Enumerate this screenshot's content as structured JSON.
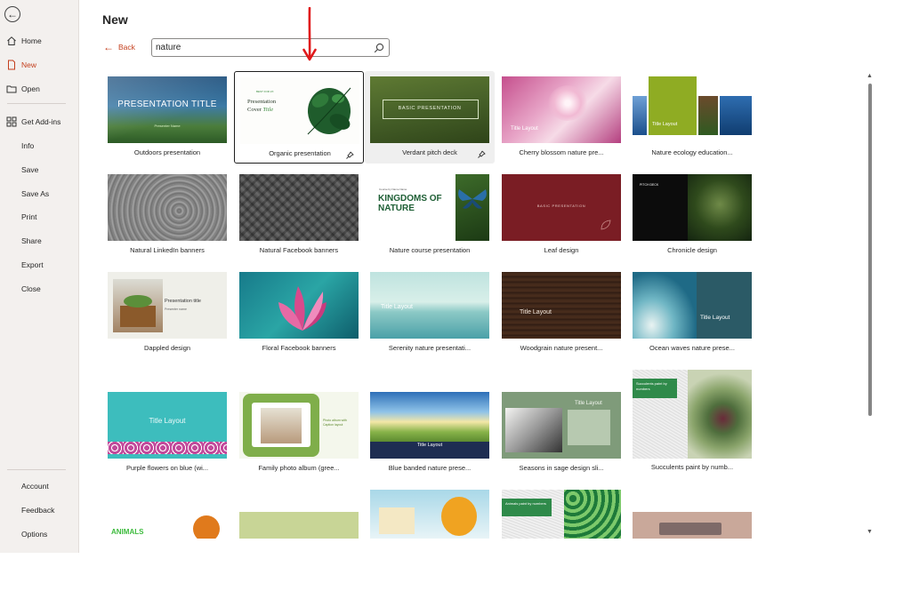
{
  "sidebar": {
    "items": [
      {
        "label": "Home"
      },
      {
        "label": "New"
      },
      {
        "label": "Open"
      },
      {
        "label": "Get Add-ins"
      },
      {
        "label": "Info"
      },
      {
        "label": "Save"
      },
      {
        "label": "Save As"
      },
      {
        "label": "Print"
      },
      {
        "label": "Share"
      },
      {
        "label": "Export"
      },
      {
        "label": "Close"
      }
    ],
    "bottom_items": [
      {
        "label": "Account"
      },
      {
        "label": "Feedback"
      },
      {
        "label": "Options"
      }
    ],
    "active": "New"
  },
  "header": {
    "title": "New",
    "back_label": "Back"
  },
  "search": {
    "value": "nature",
    "icon": "search-icon"
  },
  "colors": {
    "accent": "#c43e1c",
    "annotation_arrow": "#e0191b",
    "sidebar_bg": "#f3f0ee"
  },
  "templates": [
    {
      "name": "Outdoors presentation",
      "thumb": {
        "title": "PRESENTATION TITLE",
        "subtitle": "Presenter Name"
      }
    },
    {
      "name": "Organic presentation",
      "thumb": {
        "line1": "Presentation",
        "line2": "Cover",
        "line3": "Title",
        "tag": "BEST FOR 2X"
      },
      "selected": true
    },
    {
      "name": "Verdant pitch deck",
      "thumb": {
        "title": "BASIC PRESENTATION"
      },
      "hover": true
    },
    {
      "name": "Cherry blossom nature pre...",
      "thumb": {
        "title": "Title Layout"
      }
    },
    {
      "name": "Nature ecology education...",
      "thumb": {
        "title": "Title Layout"
      }
    },
    {
      "name": "Natural LinkedIn banners",
      "thumb": {}
    },
    {
      "name": "Natural Facebook banners",
      "thumb": {}
    },
    {
      "name": "Nature course presentation",
      "thumb": {
        "title": "KINGDOMS OF NATURE",
        "top": "Course by Name Name"
      }
    },
    {
      "name": "Leaf design",
      "thumb": {
        "title": "BASIC PRESENTATION"
      }
    },
    {
      "name": "Chronicle design",
      "thumb": {
        "title": "PITCH DECK"
      }
    },
    {
      "name": "Dappled design",
      "thumb": {
        "title": "Presentation title",
        "subtitle": "Presenter name"
      }
    },
    {
      "name": "Floral Facebook banners",
      "thumb": {}
    },
    {
      "name": "Serenity nature presentati...",
      "thumb": {
        "title": "Title Layout"
      }
    },
    {
      "name": "Woodgrain nature present...",
      "thumb": {
        "title": "Title Layout"
      }
    },
    {
      "name": "Ocean waves nature prese...",
      "thumb": {
        "title": "Title Layout"
      }
    },
    {
      "name": "Purple flowers on blue (wi...",
      "thumb": {
        "title": "Title Layout"
      }
    },
    {
      "name": "Family photo album (gree...",
      "thumb": {
        "title": "Photo album with Caption layout"
      }
    },
    {
      "name": "Blue banded nature prese...",
      "thumb": {
        "title": "Title Layout"
      }
    },
    {
      "name": "Seasons in sage design sli...",
      "thumb": {
        "title": "Title Layout"
      }
    },
    {
      "name": "Succulents paint by numb...",
      "thumb": {
        "title": "Succulents paint by numbers"
      }
    },
    {
      "name": "",
      "thumb": {
        "title": "ANIMALS"
      }
    },
    {
      "name": "",
      "thumb": {}
    },
    {
      "name": "",
      "thumb": {}
    },
    {
      "name": "",
      "thumb": {
        "title": "Animals paint by numbers"
      }
    },
    {
      "name": "",
      "thumb": {}
    }
  ]
}
